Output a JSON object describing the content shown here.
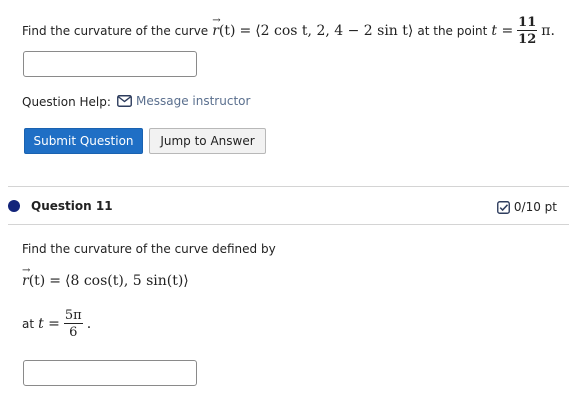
{
  "question10": {
    "prompt_prefix": "Find the curvature of the curve",
    "r_symbol": "r",
    "r_arg": "(t)",
    "equals": "=",
    "vector_expr": "⟨2 cos t, 2, 4 − 2 sin t⟩",
    "at_the_point": "at the point",
    "t_var": "t",
    "frac_num": "11",
    "frac_den": "12",
    "pi_tail": "π.",
    "answer_value": "",
    "help_label": "Question Help:",
    "message_instructor": "Message instructor",
    "submit_label": "Submit Question",
    "jump_label": "Jump to Answer"
  },
  "question11": {
    "title": "Question 11",
    "points": "0/10 pt",
    "prompt": "Find the curvature of the curve defined by",
    "r_symbol": "r",
    "r_arg": "(t)",
    "equals": "=",
    "vector_expr": "⟨8 cos(t), 5 sin(t)⟩",
    "at_label": "at",
    "t_var": "t",
    "frac_num": "5π",
    "frac_den": "6",
    "period": ".",
    "answer_value": ""
  },
  "colors": {
    "primary_button": "#1f6fc5",
    "link": "#5a6f8e",
    "question_dot": "#13247a"
  },
  "icons": {
    "message": "envelope-icon",
    "points": "checkbox-icon"
  }
}
